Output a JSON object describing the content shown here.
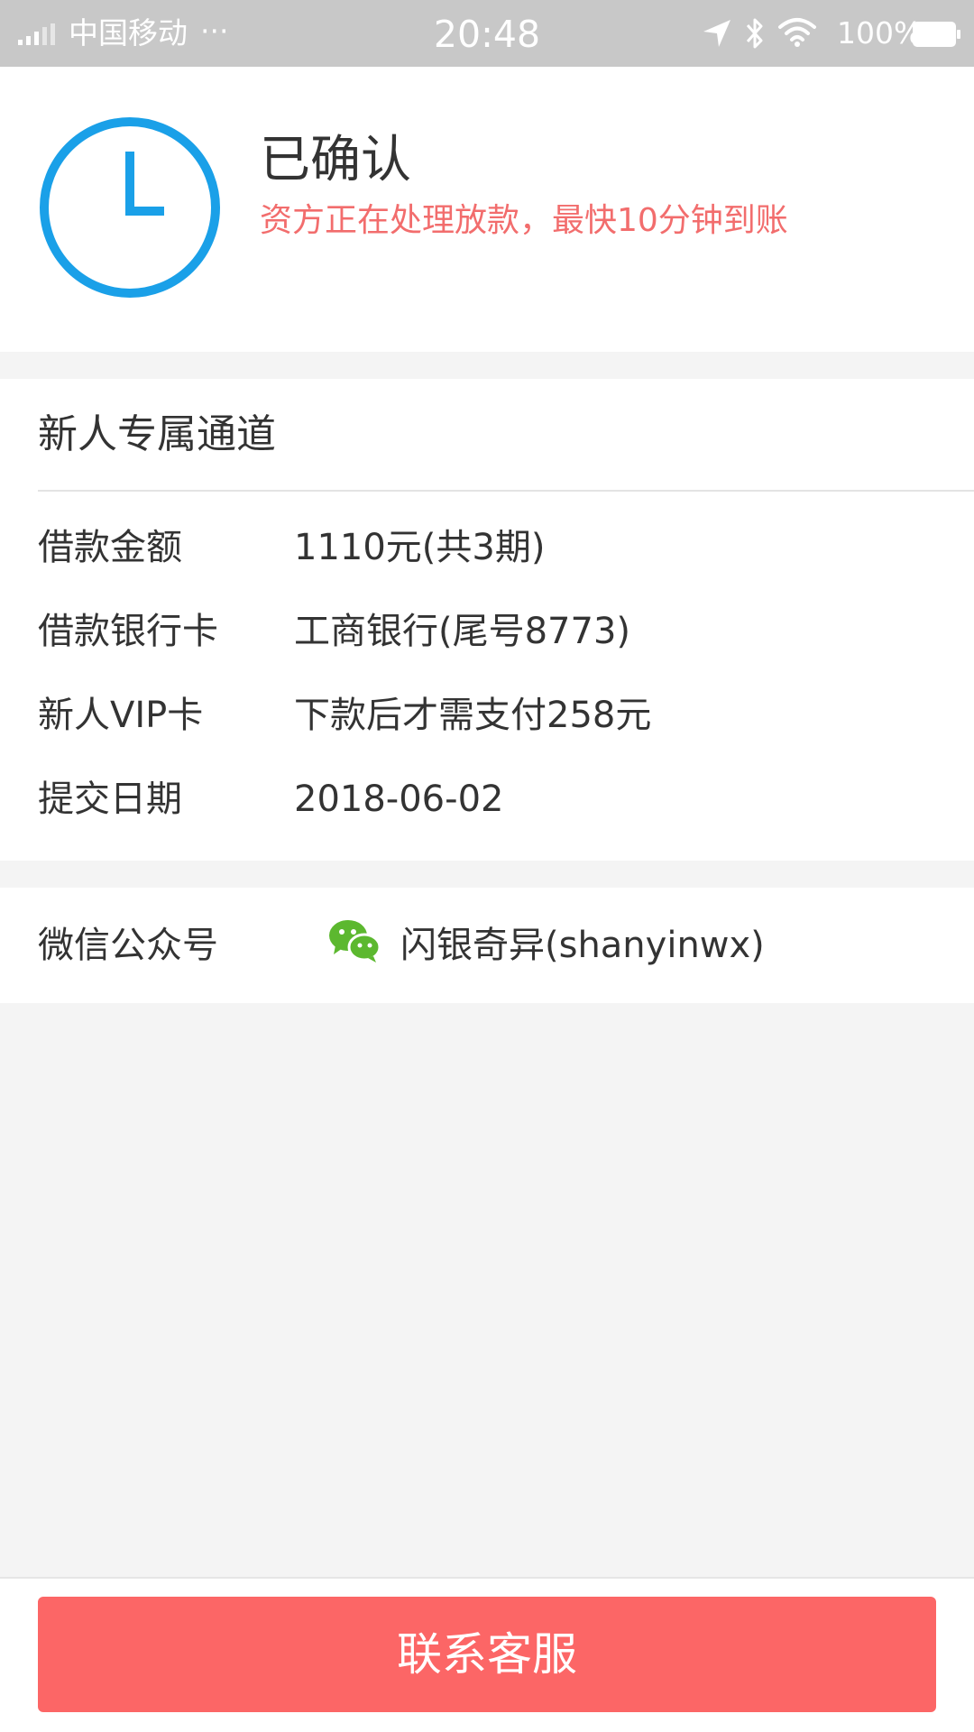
{
  "status_bar": {
    "carrier": "中国移动",
    "dots": "···",
    "time": "20:48",
    "battery": "100%"
  },
  "status": {
    "title": "已确认",
    "subtitle": "资方正在处理放款，最快10分钟到账",
    "icon": "clock-icon",
    "accent_color": "#1aa0e8",
    "subtitle_color": "#f26d6d"
  },
  "details": {
    "section_title": "新人专属通道",
    "rows": [
      {
        "label": "借款金额",
        "value": "1110元(共3期)"
      },
      {
        "label": "借款银行卡",
        "value": "工商银行(尾号8773)"
      },
      {
        "label": "新人VIP卡",
        "value": "下款后才需支付258元"
      },
      {
        "label": "提交日期",
        "value": "2018-06-02"
      }
    ]
  },
  "wechat": {
    "label": "微信公众号",
    "icon": "wechat-icon",
    "value": "闪银奇异(shanyinwx)"
  },
  "actions": {
    "contact_label": "联系客服",
    "button_color": "#fc6666"
  }
}
